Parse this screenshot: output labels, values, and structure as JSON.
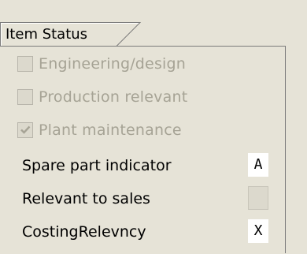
{
  "tab": {
    "label": "Item Status"
  },
  "checkboxes": [
    {
      "label": "Engineering/design",
      "checked": false
    },
    {
      "label": "Production relevant",
      "checked": false
    },
    {
      "label": "Plant maintenance",
      "checked": true
    }
  ],
  "fields": [
    {
      "label": "Spare part indicator",
      "value": "A"
    },
    {
      "label": "Relevant to sales",
      "value": ""
    },
    {
      "label": "CostingRelevncy",
      "value": "X"
    }
  ]
}
